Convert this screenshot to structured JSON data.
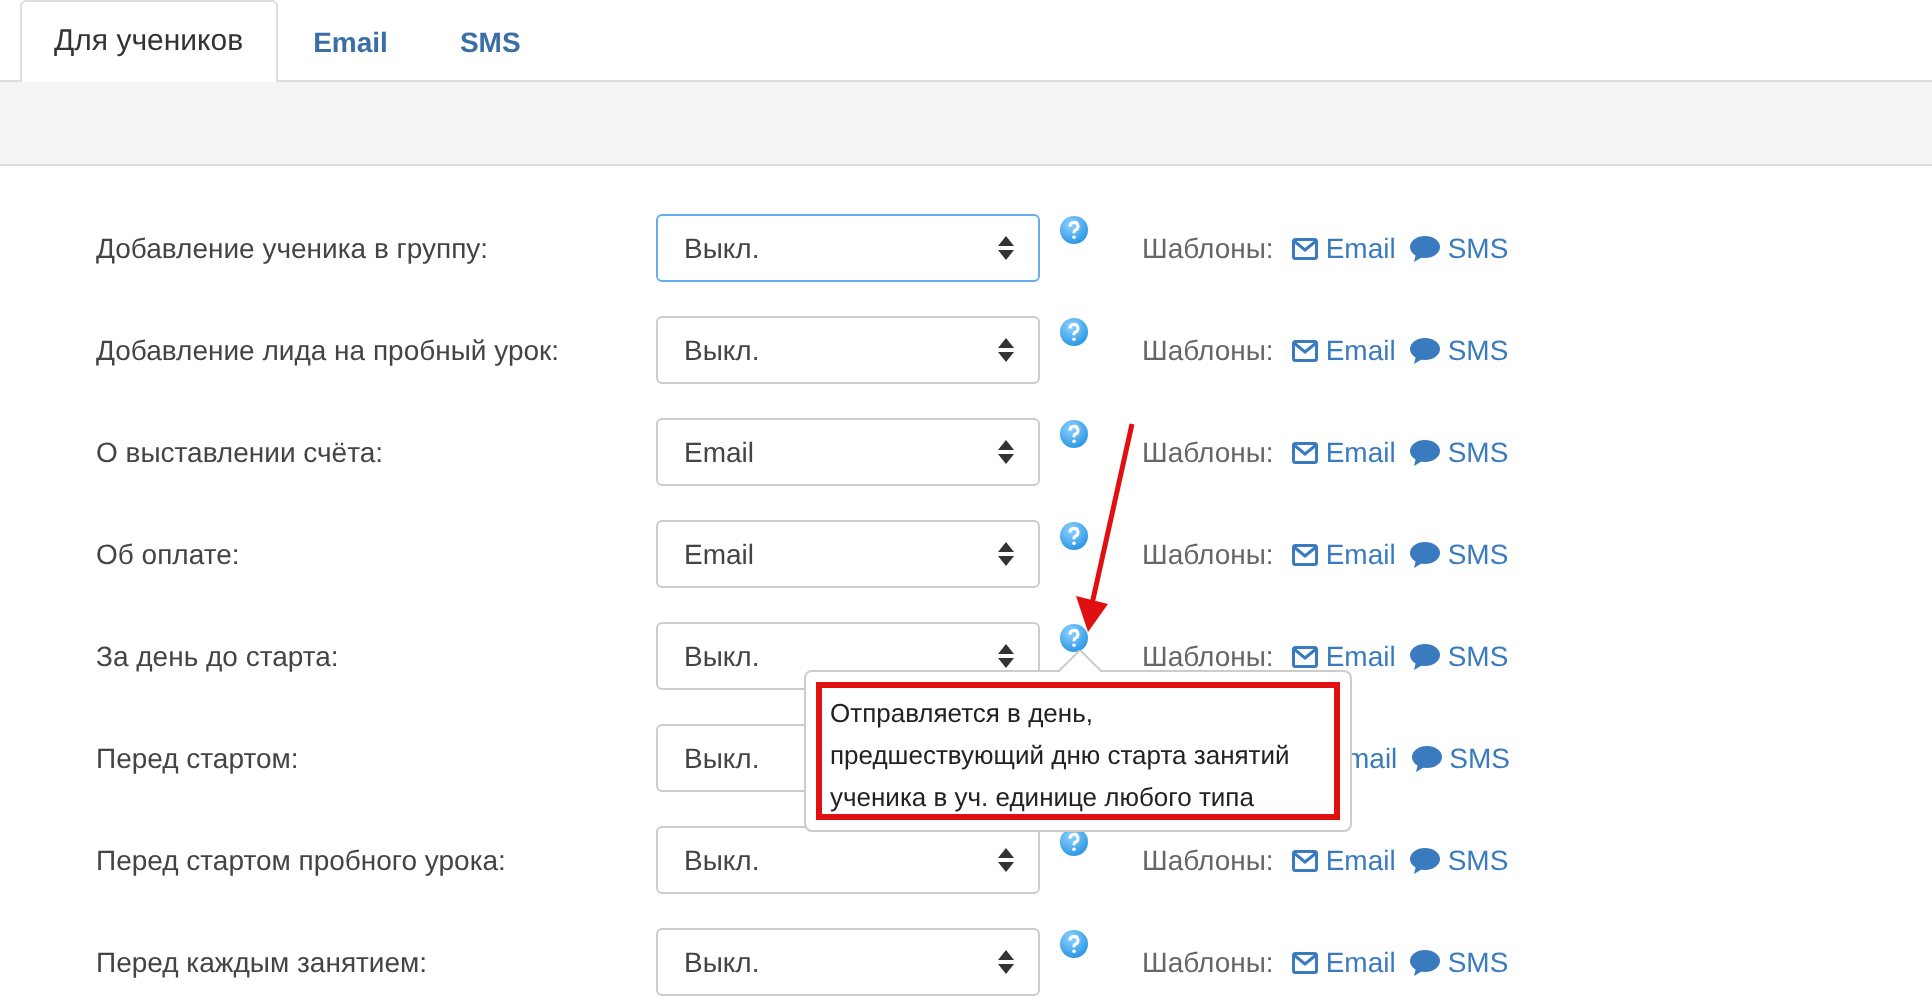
{
  "tabs": [
    {
      "label": "Для учеников",
      "selected": true
    },
    {
      "label": "Email",
      "selected": false
    },
    {
      "label": "SMS",
      "selected": false
    }
  ],
  "rows": [
    {
      "label": "Добавление ученика в группу:",
      "value": "Выкл.",
      "focused": true,
      "caret": true,
      "help_icon": true,
      "templates_label": "Шаблоны:",
      "email": "Email",
      "email_icon": true,
      "sms": "SMS"
    },
    {
      "label": "Добавление лида на пробный урок:",
      "value": "Выкл.",
      "focused": false,
      "caret": true,
      "help_icon": true,
      "templates_label": "Шаблоны:",
      "email": "Email",
      "email_icon": true,
      "sms": "SMS"
    },
    {
      "label": "О выставлении счёта:",
      "value": "Email",
      "focused": false,
      "caret": true,
      "help_icon": true,
      "templates_label": "Шаблоны:",
      "email": "Email",
      "email_icon": true,
      "sms": "SMS"
    },
    {
      "label": "Об оплате:",
      "value": "Email",
      "focused": false,
      "caret": true,
      "help_icon": true,
      "templates_label": "Шаблоны:",
      "email": "Email",
      "email_icon": true,
      "sms": "SMS"
    },
    {
      "label": "За день до старта:",
      "value": "Выкл.",
      "focused": false,
      "caret": true,
      "help_icon": true,
      "templates_label": "Шаблоны:",
      "email": "Email",
      "email_icon": true,
      "sms": "SMS"
    },
    {
      "label": "Перед стартом:",
      "value": "Выкл.",
      "focused": false,
      "caret": false,
      "help_icon": false,
      "email": "mail",
      "email_icon": false,
      "sms": "SMS"
    },
    {
      "label": "Перед стартом пробного урока:",
      "value": "Выкл.",
      "focused": false,
      "caret": true,
      "help_icon": true,
      "templates_label": "Шаблоны:",
      "email": "Email",
      "email_icon": true,
      "sms": "SMS"
    },
    {
      "label": "Перед каждым занятием:",
      "value": "Выкл.",
      "focused": false,
      "caret": true,
      "help_icon": true,
      "templates_label": "Шаблоны:",
      "email": "Email",
      "email_icon": true,
      "sms": "SMS"
    }
  ],
  "tooltip": {
    "text": "Отправляется в день, предшествующий дню старта занятий ученика в уч. единице любого типа"
  }
}
